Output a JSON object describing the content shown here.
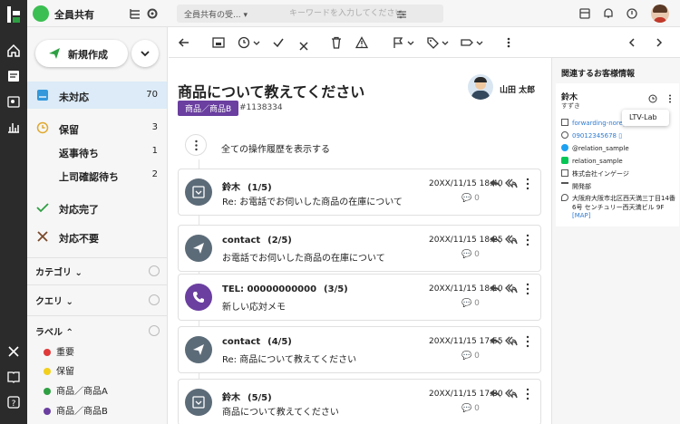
{
  "topbar": {
    "workspace": "全員共有",
    "search_scope": "全員共有の受...",
    "search_placeholder": "キーワードを入力してください"
  },
  "sidebar": {
    "new_button": "新規作成",
    "statuses": [
      {
        "label": "未対応",
        "count": "70"
      },
      {
        "label": "保留",
        "count": "3"
      },
      {
        "label": "返事待ち",
        "count": "1"
      },
      {
        "label": "上司確認待ち",
        "count": "2"
      },
      {
        "label": "対応完了",
        "count": ""
      },
      {
        "label": "対応不要",
        "count": ""
      }
    ],
    "sections": {
      "category": "カテゴリ",
      "query": "クエリ",
      "label": "ラベル"
    },
    "labels": [
      {
        "name": "重要",
        "color": "#e03a3a"
      },
      {
        "name": "保留",
        "color": "#f2cf1d"
      },
      {
        "name": "商品／商品A",
        "color": "#2ea043"
      },
      {
        "name": "商品／商品B",
        "color": "#6a3fa0"
      }
    ]
  },
  "ticket": {
    "subject": "商品について教えてください",
    "tag": "商品／商品B",
    "id": "#1138334",
    "assignee": "山田 太郎",
    "history_label": "全ての操作履歴を表示する"
  },
  "messages": [
    {
      "from": "鈴木",
      "index": "(1/5)",
      "body": "Re: お電話でお伺いした商品の在庫について",
      "date": "20XX/11/15 18:40",
      "comments": "0",
      "type": "inbox-icon",
      "color": "#5c6b78"
    },
    {
      "from": "contact",
      "index": "(2/5)",
      "body": "お電話でお伺いした商品の在庫について",
      "date": "20XX/11/15 18:25",
      "comments": "0",
      "type": "send-icon",
      "color": "#5c6b78"
    },
    {
      "from": "TEL: 00000000000",
      "index": "(3/5)",
      "body": "新しい応対メモ",
      "date": "20XX/11/15 18:10",
      "comments": "0",
      "type": "phone-icon",
      "color": "#6a3fa0"
    },
    {
      "from": "contact",
      "index": "(4/5)",
      "body": "Re: 商品について教えてください",
      "date": "20XX/11/15 17:55",
      "comments": "0",
      "type": "send-icon",
      "color": "#5c6b78"
    },
    {
      "from": "鈴木",
      "index": "(5/5)",
      "body": "商品について教えてください",
      "date": "20XX/11/15 17:30",
      "comments": "0",
      "type": "inbox-icon",
      "color": "#5c6b78"
    }
  ],
  "customer": {
    "panel_title": "関連するお客様情報",
    "name": "鈴木",
    "kana": "すずき",
    "email": "forwarding-norepl",
    "phone": "09012345678",
    "twitter": "@relation_sample",
    "line": "relation_sample",
    "company": "株式会社インゲージ",
    "department": "開発部",
    "address_line1": "大阪府大阪市北区西天満三丁目14番",
    "address_line2": "6号 センチュリー西天満ビル 9F",
    "map_link": "[MAP]",
    "tooltip": "LTV-Lab"
  },
  "colors": {
    "accent_green": "#2ea043",
    "active_bg": "#dcebf7",
    "tag_purple": "#6a3fa0"
  }
}
